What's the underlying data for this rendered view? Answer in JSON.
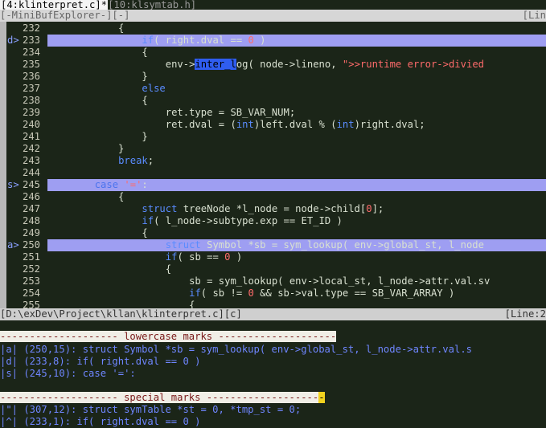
{
  "tabline": {
    "active_tab": "[4:klinterpret.c]*",
    "inactive_tab": "[10:klsymtab.h]"
  },
  "minibuf": {
    "text": "[-MiniBufExplorer-][-]",
    "right": "[Lin"
  },
  "editor": {
    "lines": [
      {
        "n": "232",
        "sign": "",
        "html": "            {"
      },
      {
        "n": "233",
        "sign": "d>",
        "hl": true,
        "html": "                <span class=\"kw\">if</span>( right.dval == <span class=\"num\">0</span> )"
      },
      {
        "n": "234",
        "sign": "",
        "html": "                {"
      },
      {
        "n": "235",
        "sign": "",
        "html": "                    env-><span class=\"search\">inter_l</span>og( node->lineno, <span class=\"str\">\">>runtime error->divied</span>"
      },
      {
        "n": "236",
        "sign": "",
        "html": "                }"
      },
      {
        "n": "237",
        "sign": "",
        "html": "                <span class=\"kw\">else</span>"
      },
      {
        "n": "238",
        "sign": "",
        "html": "                {"
      },
      {
        "n": "239",
        "sign": "",
        "html": "                    ret.type = SB_VAR_NUM;"
      },
      {
        "n": "240",
        "sign": "",
        "html": "                    ret.dval = (<span class=\"kw\">int</span>)left.dval % (<span class=\"kw\">int</span>)right.dval;"
      },
      {
        "n": "241",
        "sign": "",
        "html": "                }"
      },
      {
        "n": "242",
        "sign": "",
        "html": "            }"
      },
      {
        "n": "243",
        "sign": "",
        "html": "            <span class=\"kw\">break</span>;"
      },
      {
        "n": "244",
        "sign": "",
        "html": ""
      },
      {
        "n": "245",
        "sign": "s>",
        "hl": true,
        "html": "        <span class=\"kw-dim\">case</span> <span class=\"str\">'='</span>:"
      },
      {
        "n": "246",
        "sign": "",
        "html": "            {"
      },
      {
        "n": "247",
        "sign": "",
        "html": "                <span class=\"kw\">struct</span> treeNode *l_node = node->child[<span class=\"num\">0</span>];"
      },
      {
        "n": "248",
        "sign": "",
        "html": "                <span class=\"kw\">if</span>( l_node->subtype.exp == ET_ID )"
      },
      {
        "n": "249",
        "sign": "",
        "html": "                {"
      },
      {
        "n": "250",
        "sign": "a>",
        "hl": true,
        "html": "                    <span class=\"kw\">struct</span> Symbol *sb = sym_lookup( env->global_st, l_node"
      },
      {
        "n": "251",
        "sign": "",
        "html": "                    <span class=\"kw\">if</span>( sb == <span class=\"num\">0</span> )"
      },
      {
        "n": "252",
        "sign": "",
        "html": "                    {"
      },
      {
        "n": "253",
        "sign": "",
        "html": "                        sb = sym_lookup( env->local_st, l_node->attr.val.sv"
      },
      {
        "n": "254",
        "sign": "",
        "html": "                        <span class=\"kw\">if</span>( sb != <span class=\"num\">0</span> && sb->val.type == SB_VAR_ARRAY )"
      },
      {
        "n": "255",
        "sign": "",
        "html": "                        {"
      }
    ]
  },
  "statusline": {
    "left": "[D:\\exDev\\Project\\kllan\\klinterpret.c][c]",
    "right": "[Line:2"
  },
  "quickfix": {
    "lower_header": "-------------------- lowercase marks --------------------",
    "lower_items": [
      "|a| (250,15): struct Symbol *sb = sym_lookup( env->global_st, l_node->attr.val.s",
      "|d| (233,8): if( right.dval == 0 )",
      "|s| (245,10): case '=':"
    ],
    "special_header": "-------------------- special marks -------------------",
    "special_items": [
      "|\"| (307,12): struct symTable *st = 0, *tmp_st = 0;",
      "|^| (233,1): if( right.dval == 0 )"
    ]
  }
}
